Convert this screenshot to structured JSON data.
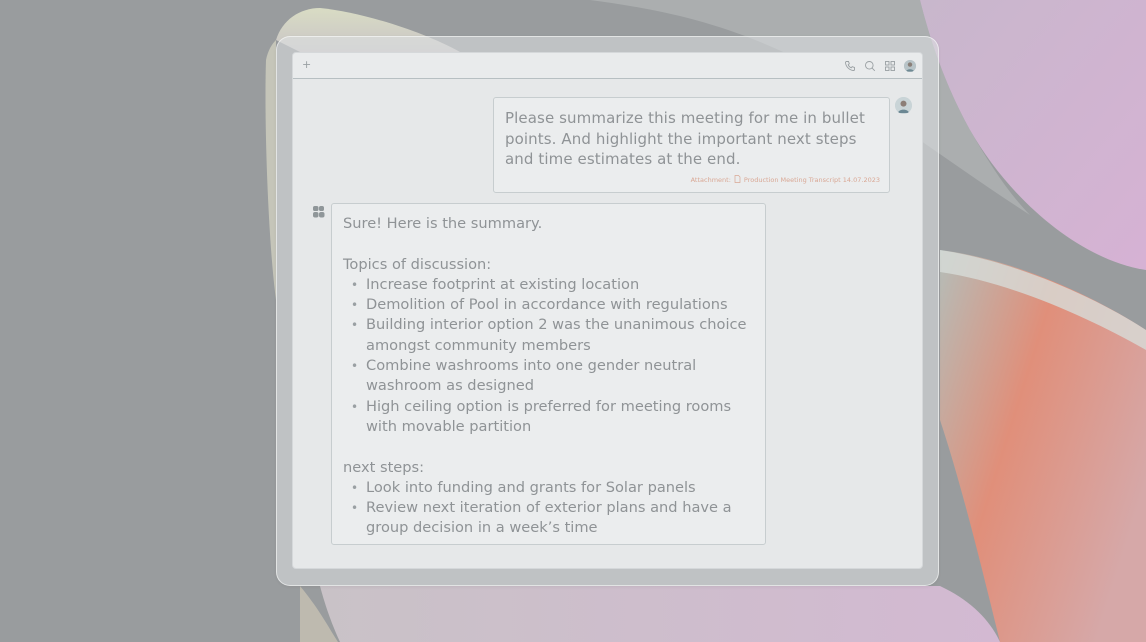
{
  "toolbar": {
    "new_label": "+",
    "icons": [
      "phone-icon",
      "search-icon",
      "grid-icon",
      "avatar"
    ]
  },
  "user_message": {
    "text": "Please summarize this meeting for me in bullet points. And highlight the important next steps and time estimates at the end.",
    "attachment_label": "Attachment:",
    "attachment_name": "Production Meeting Transcript 14.07.2023"
  },
  "assistant_message": {
    "intro": "Sure! Here is the summary.",
    "topics_heading": "Topics of discussion:",
    "topics": [
      "Increase footprint at existing location",
      "Demolition of Pool in accordance with regulations",
      "Building interior option 2 was the unanimous choice amongst community members",
      "Combine washrooms into one gender neutral washroom as designed",
      "High ceiling option is preferred for meeting rooms with movable partition"
    ],
    "next_heading": "next steps:",
    "next_steps": [
      "Look into funding and grants for Solar panels",
      "Review next iteration of exterior plans and have a group decision in a week’s time"
    ]
  },
  "colors": {
    "background": "#999c9e",
    "accent_pink": "#d8b4d8",
    "accent_coral": "#e0a08a",
    "text": "#8f9396",
    "attachment": "#d9a794"
  }
}
